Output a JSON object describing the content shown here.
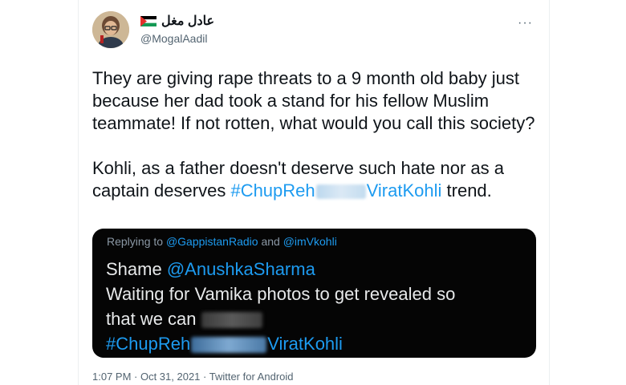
{
  "author": {
    "display_name": "عادل مغل",
    "handle": "@MogalAadil",
    "avatar_icon": "person-avatar",
    "flag_icon": "palestine-flag"
  },
  "menu": {
    "more_label": "···"
  },
  "tweet": {
    "paragraph1": "They are giving rape threats to a 9 month old baby just because her dad took a stand for his fellow Muslim teammate! If not rotten,  what would you call this society?",
    "paragraph2_text": "Kohli, as a father doesn't deserve such hate nor as a captain deserves",
    "hashtag_start": "#ChupReh",
    "hashtag_end": "ViratKohli",
    "paragraph2_suffix": " trend."
  },
  "quoted": {
    "replying_prefix": "Replying to",
    "replying_mention1": "@GappistanRadio",
    "replying_and": "and",
    "replying_mention2": "@imVkohli",
    "line1_prefix": "Shame",
    "line1_mention": "@AnushkaSharma",
    "line2": "Waiting for Vamika photos to get revealed so",
    "line3_prefix": "that we can",
    "line4_hashtag_start": "#ChupReh",
    "line4_hashtag_end": "ViratKohli"
  },
  "meta": {
    "timestamp": "1:07 PM · Oct 31, 2021 · Twitter for Android"
  },
  "colors": {
    "link": "#1d9bf0",
    "text": "#0f1419",
    "muted": "#536471",
    "quote_bg": "#050505"
  }
}
